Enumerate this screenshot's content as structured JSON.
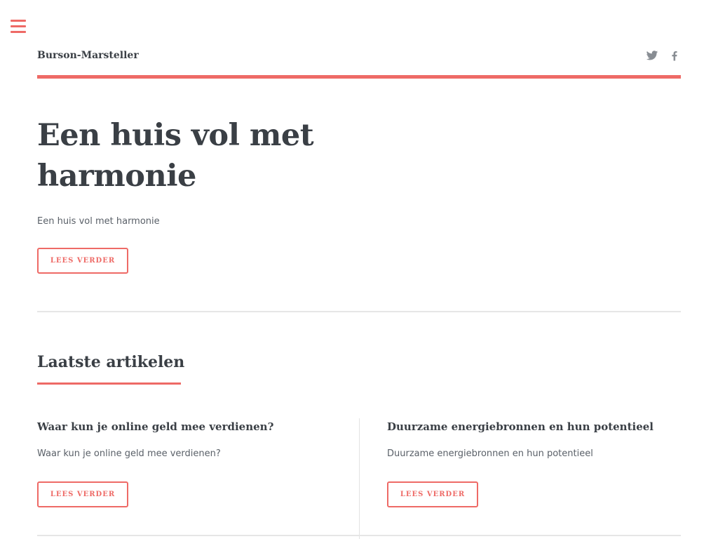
{
  "site": {
    "title": "Burson-Marsteller"
  },
  "header": {
    "social": [
      {
        "icon": "twitter-icon"
      },
      {
        "icon": "facebook-icon"
      }
    ]
  },
  "colors": {
    "accent": "#ee6a66",
    "text": "#3a3f45",
    "muted": "#5a6068",
    "rule": "#e6e6e6"
  },
  "hero": {
    "title": "Een huis vol met harmonie",
    "excerpt": "Een huis vol met harmonie",
    "button_label": "LEES VERDER"
  },
  "latest": {
    "heading": "Laatste artikelen",
    "articles": [
      {
        "title": "Waar kun je online geld mee verdienen?",
        "excerpt": "Waar kun je online geld mee verdienen?",
        "button_label": "LEES VERDER"
      },
      {
        "title": "Duurzame energiebronnen en hun potentieel",
        "excerpt": "Duurzame energiebronnen en hun potentieel",
        "button_label": "LEES VERDER"
      }
    ]
  }
}
